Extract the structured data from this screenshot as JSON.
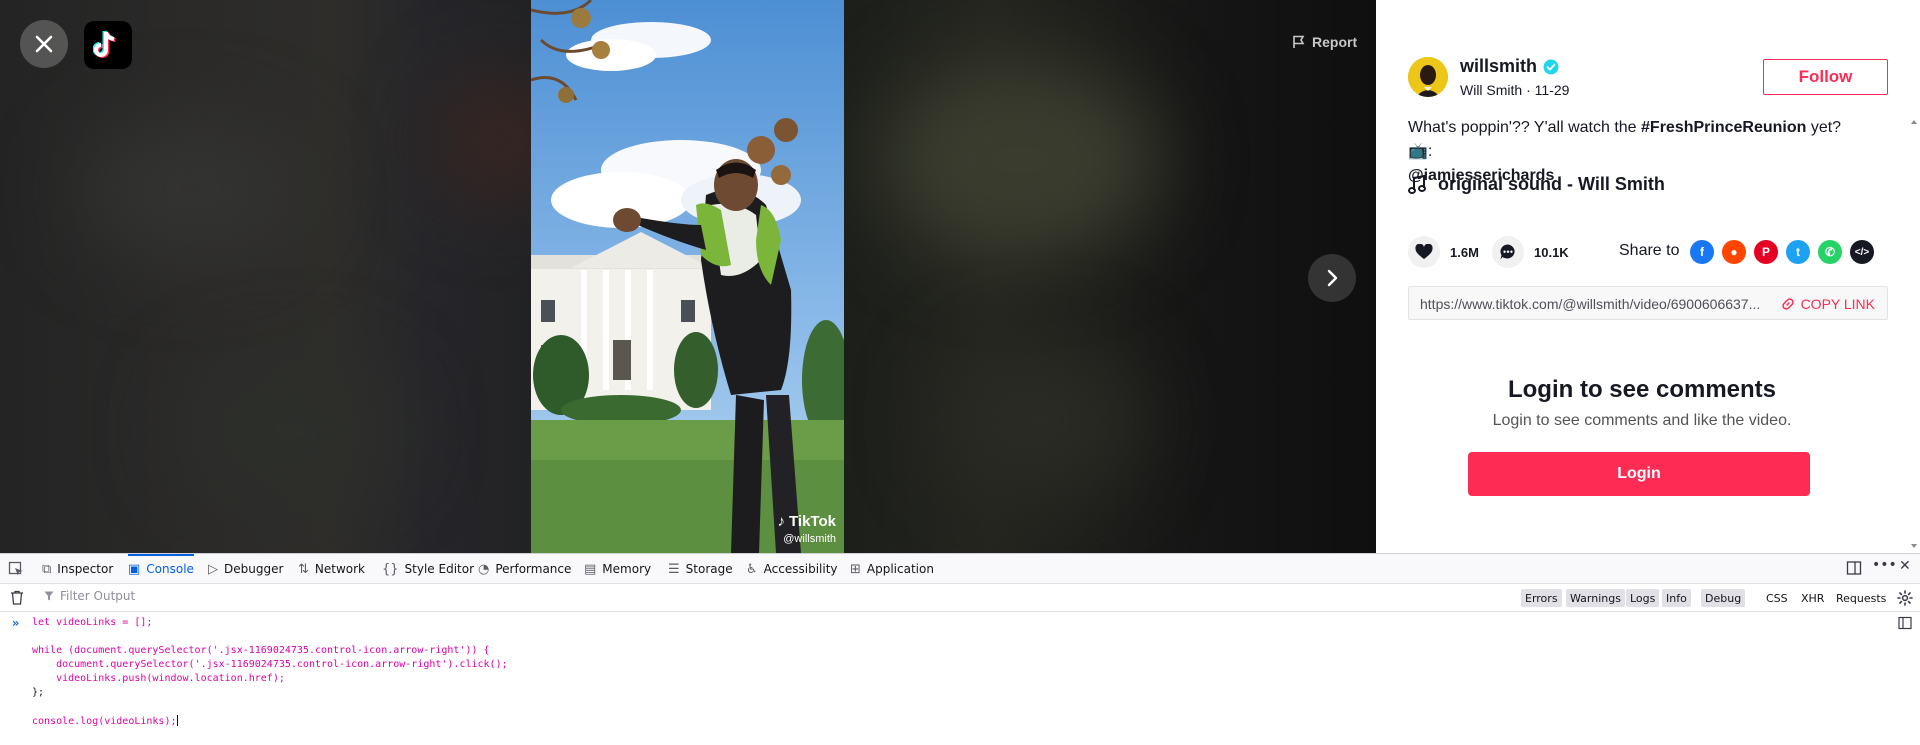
{
  "player": {
    "close_icon": "close-icon",
    "logo_icon": "tiktok-logo",
    "report_label": "Report",
    "watermark_brand": "TikTok",
    "watermark_handle": "@willsmith",
    "next_icon": "chevron-right-icon"
  },
  "author": {
    "username": "willsmith",
    "verified": true,
    "display_name": "Will Smith",
    "date": "11-29",
    "subline": "Will Smith · 11-29",
    "follow_label": "Follow"
  },
  "caption": {
    "text_before": "What's poppin'?? Y'all watch the ",
    "hashtag": "#FreshPrinceReunion",
    "text_after": " yet? 📺:",
    "mention": "@iamjesserichards"
  },
  "sound": {
    "title": "original sound - Will Smith"
  },
  "stats": {
    "likes": "1.6M",
    "comments": "10.1K"
  },
  "share": {
    "label": "Share to",
    "targets": [
      "facebook",
      "reddit",
      "pinterest",
      "twitter",
      "whatsapp",
      "embed"
    ],
    "url": "https://www.tiktok.com/@willsmith/video/6900606637...",
    "copy_label": "COPY LINK"
  },
  "comments": {
    "title": "Login to see comments",
    "subtitle": "Login to see comments and like the video.",
    "login_label": "Login"
  },
  "devtools": {
    "tabs": [
      "Inspector",
      "Console",
      "Debugger",
      "Network",
      "Style Editor",
      "Performance",
      "Memory",
      "Storage",
      "Accessibility",
      "Application"
    ],
    "selected_tab": "Console",
    "filter_placeholder": "Filter Output",
    "filters": [
      "Errors",
      "Warnings",
      "Logs",
      "Info",
      "Debug",
      "CSS",
      "XHR",
      "Requests"
    ],
    "console_lines": [
      "let videoLinks = [];",
      "",
      "while (document.querySelector('.jsx-1169024735.control-icon.arrow-right')) {",
      "    document.querySelector('.jsx-1169024735.control-icon.arrow-right').click();",
      "    videoLinks.push(window.location.href);",
      "};",
      "",
      "console.log(videoLinks);"
    ]
  },
  "colors": {
    "brand": "#fe2c55",
    "devtools_accent": "#0061e0"
  }
}
